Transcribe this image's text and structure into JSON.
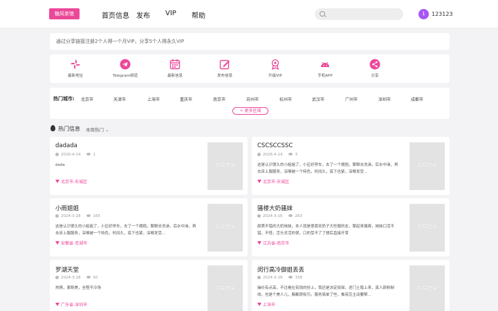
{
  "header": {
    "logo": "糖风茶馆",
    "nav": [
      "首页信息",
      "发布",
      "VIP",
      "帮助"
    ],
    "search": {
      "placeholder": ""
    },
    "user": {
      "avatar_text": "1",
      "name": "123123"
    }
  },
  "notice": "通过分享链接注册2个人得一个月VIP，分享5个人得永久VIP",
  "quick_links": [
    {
      "label": "最新地址",
      "icon": "pinwheel-icon"
    },
    {
      "label": "Telegram频道",
      "icon": "telegram-icon"
    },
    {
      "label": "最新信息",
      "icon": "calendar-icon"
    },
    {
      "label": "发布信息",
      "icon": "edit-icon"
    },
    {
      "label": "升级VIP",
      "icon": "vip-badge-icon"
    },
    {
      "label": "手机APP",
      "icon": "android-icon"
    },
    {
      "label": "分享",
      "icon": "share-icon"
    }
  ],
  "cities": {
    "label": "热门城市:",
    "items": [
      "北京市",
      "天津市",
      "上海市",
      "重庆市",
      "南京市",
      "苏州市",
      "杭州市",
      "武汉市",
      "广州市",
      "深圳市",
      "成都市"
    ],
    "more": "更多区域"
  },
  "section": {
    "title": "热门信息",
    "filter": "本周热门 ⌄"
  },
  "posts": [
    {
      "title": "dadada",
      "date": "2026-4-14",
      "views": "1",
      "desc": "dada",
      "location": "北京市-东城区",
      "thumb": "加载错误"
    },
    {
      "title": "CSCSCCSSC",
      "date": "2026-4-14",
      "views": "3",
      "desc": "这是认识很久的小姐姐了，小区好停车，去了一个拥抱，聊聊去洗澡，后水中澡，再去床上服服务，深喉被一个特色，时间久，底下也紧，深喉发受...",
      "location": "北京市-东城区",
      "thumb": "加载错误"
    },
    {
      "title": "小雨姐姐",
      "date": "2024-3-18",
      "views": "165",
      "desc": "这是认识很久的小姐姐了，小区好停车，去了一个拥抱，聊聊去洗澡，后水中澡，再去床上服服务，深喉被一个特色，时间久，底下也紧，深喉发受...",
      "location": "安徽省-芜湖市",
      "thumb": "加载错误"
    },
    {
      "title": "骚楼大奶骚妹",
      "date": "2024-3-16",
      "views": "263",
      "desc": "颜质不错的大奶妹妹，本人就是很喜欢奶子大些服的女，擎起来揣爽，妹妹口活不错，不怪，舌头灵活的很，口的受不了了想后直接开草",
      "location": "江苏省-南京市",
      "thumb": "加载错误"
    },
    {
      "title": "罗湖天堂",
      "date": "2024-3-18",
      "views": "50",
      "desc": "热情，紧断美，全程不冷场",
      "location": "广东省-深圳市",
      "thumb": "加载错误"
    },
    {
      "title": "闵行高冷御姐丢丢",
      "date": "2024-3-18",
      "views": "158",
      "desc": "操价有点高，不过看在有钱的份上，我还是决定探探。进门土隐上来，真人颜粉制线，也是个美人儿，胸都很吸引。服务简单了些，推亮完主动要帮...",
      "location": "上海市",
      "thumb": "加载错误"
    }
  ]
}
